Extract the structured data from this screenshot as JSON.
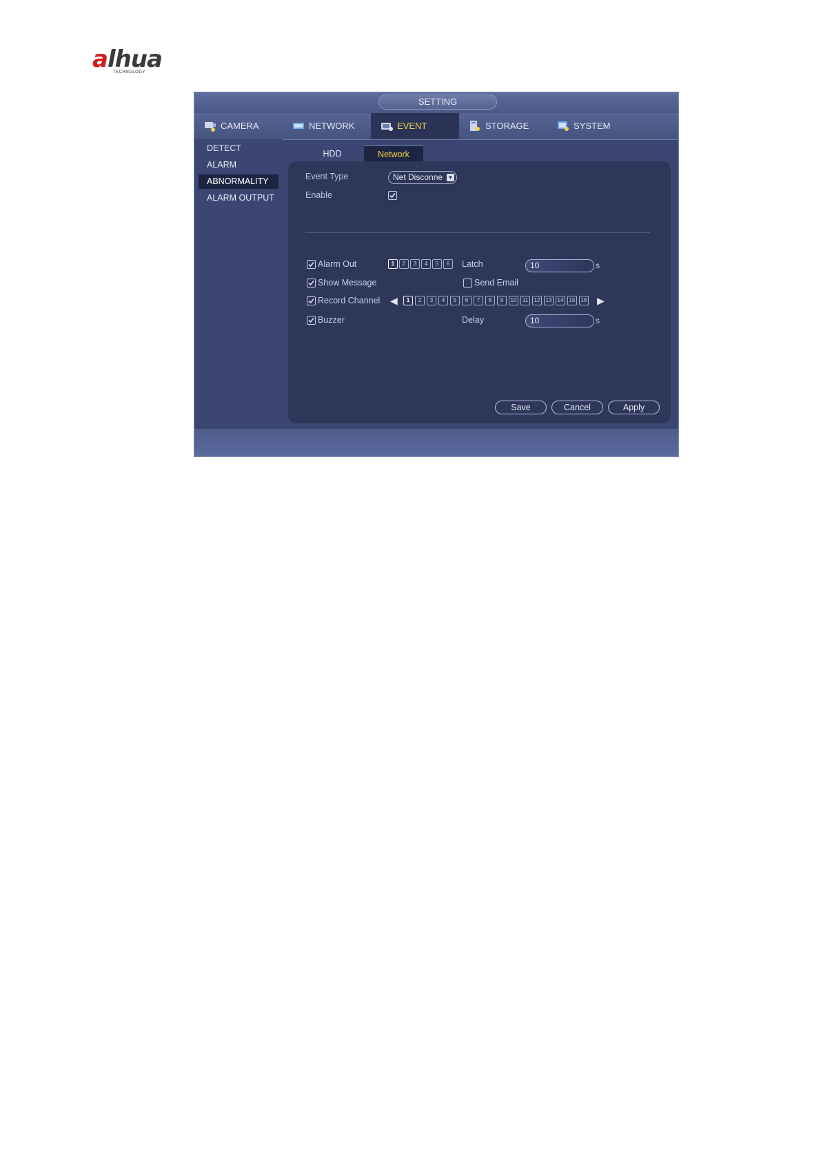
{
  "logo": {
    "main_a": "a",
    "main_rest": "lhua",
    "sub": "TECHNOLOGY"
  },
  "window": {
    "title": "SETTING"
  },
  "nav": {
    "tabs": [
      {
        "label": "CAMERA",
        "icon": "camera-icon"
      },
      {
        "label": "NETWORK",
        "icon": "network-icon"
      },
      {
        "label": "EVENT",
        "icon": "event-icon"
      },
      {
        "label": "STORAGE",
        "icon": "storage-icon"
      },
      {
        "label": "SYSTEM",
        "icon": "system-icon"
      }
    ],
    "active": "EVENT"
  },
  "sidebar": {
    "items": [
      {
        "label": "DETECT"
      },
      {
        "label": "ALARM"
      },
      {
        "label": "ABNORMALITY"
      },
      {
        "label": "ALARM OUTPUT"
      }
    ],
    "active": "ABNORMALITY"
  },
  "subtabs": {
    "items": [
      {
        "label": "HDD"
      },
      {
        "label": "Network"
      }
    ],
    "active": "Network"
  },
  "form": {
    "event_type_label": "Event Type",
    "event_type_value": "Net Disconne",
    "enable_label": "Enable",
    "enable_checked": true,
    "alarm_out_label": "Alarm Out",
    "alarm_out_checked": true,
    "alarm_out_channels": [
      "1",
      "2",
      "3",
      "4",
      "5",
      "6"
    ],
    "latch_label": "Latch",
    "latch_value": "10",
    "latch_unit": "s",
    "show_message_label": "Show Message",
    "show_message_checked": true,
    "send_email_label": "Send Email",
    "send_email_checked": false,
    "record_channel_label": "Record Channel",
    "record_channel_checked": true,
    "record_channels": [
      "1",
      "2",
      "3",
      "4",
      "5",
      "6",
      "7",
      "8",
      "9",
      "10",
      "11",
      "12",
      "13",
      "14",
      "15",
      "16"
    ],
    "buzzer_label": "Buzzer",
    "buzzer_checked": true,
    "delay_label": "Delay",
    "delay_value": "10",
    "delay_unit": "s"
  },
  "buttons": {
    "save": "Save",
    "cancel": "Cancel",
    "apply": "Apply"
  },
  "colors": {
    "accent": "#f2d34a",
    "panel": "#2e365a",
    "window": "#3b4673",
    "logo_red": "#d11d1d"
  }
}
